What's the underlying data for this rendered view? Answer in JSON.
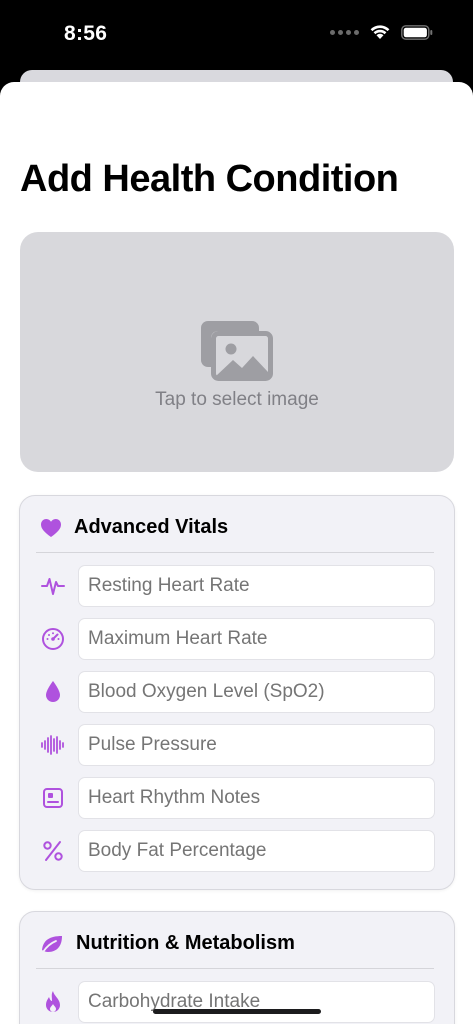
{
  "status_bar": {
    "time": "8:56"
  },
  "page": {
    "title": "Add Health Condition"
  },
  "image_picker": {
    "hint": "Tap to select image"
  },
  "sections": [
    {
      "title": "Advanced Vitals",
      "icon": "heart-icon",
      "fields": [
        {
          "icon": "waveform-icon",
          "placeholder": "Resting Heart Rate"
        },
        {
          "icon": "gauge-icon",
          "placeholder": "Maximum Heart Rate"
        },
        {
          "icon": "drop-icon",
          "placeholder": "Blood Oxygen Level (SpO2)"
        },
        {
          "icon": "pulse-wave-icon",
          "placeholder": "Pulse Pressure"
        },
        {
          "icon": "notes-card-icon",
          "placeholder": "Heart Rhythm Notes"
        },
        {
          "icon": "percent-icon",
          "placeholder": "Body Fat Percentage"
        }
      ]
    },
    {
      "title": "Nutrition & Metabolism",
      "icon": "leaf-icon",
      "fields": [
        {
          "icon": "flame-icon",
          "placeholder": "Carbohydrate Intake"
        }
      ]
    }
  ],
  "colors": {
    "accent": "#af52de",
    "background": "#ffffff",
    "card": "#f2f2f7",
    "placeholder": "#c7c7cc"
  }
}
